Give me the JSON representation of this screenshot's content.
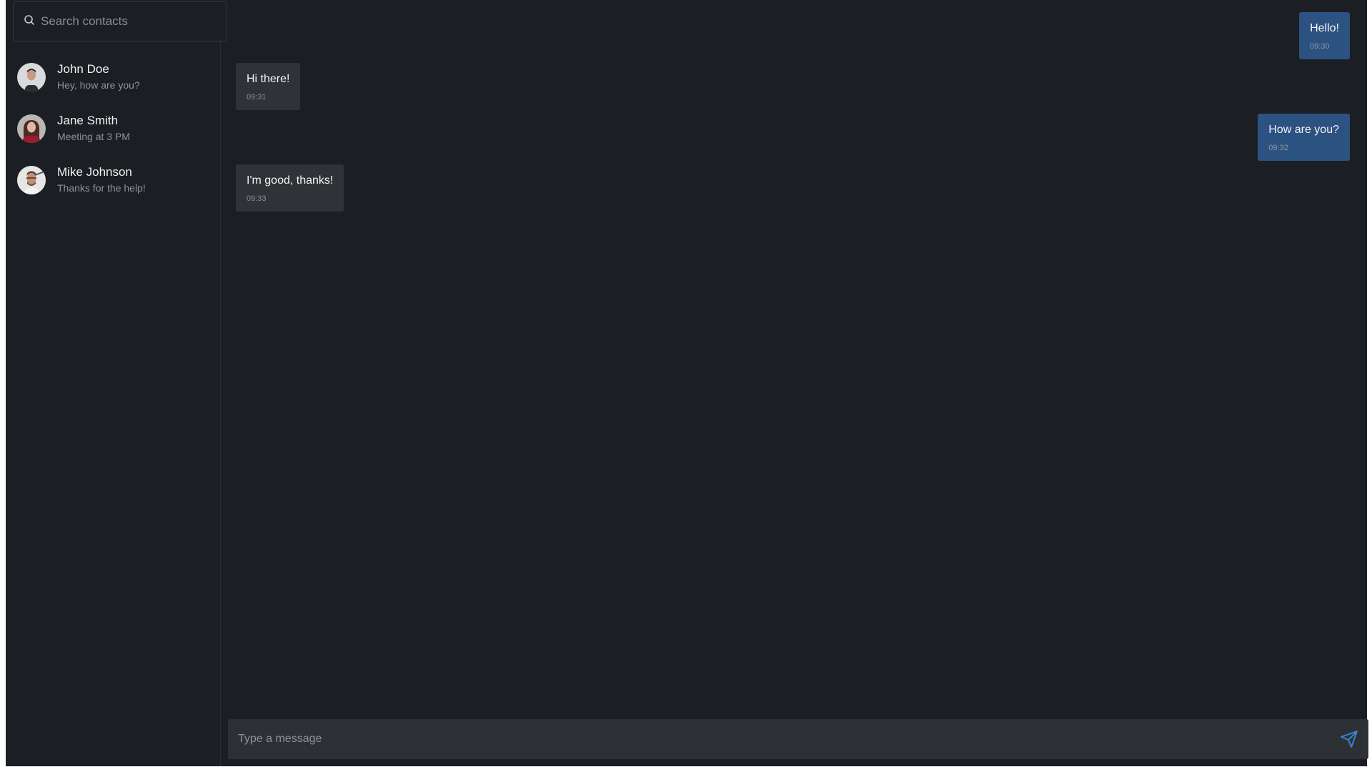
{
  "search": {
    "placeholder": "Search contacts"
  },
  "contacts": [
    {
      "name": "John Doe",
      "preview": "Hey, how are you?"
    },
    {
      "name": "Jane Smith",
      "preview": "Meeting at 3 PM"
    },
    {
      "name": "Mike Johnson",
      "preview": "Thanks for the help!"
    }
  ],
  "messages": [
    {
      "text": "Hello!",
      "time": "09:30",
      "direction": "out"
    },
    {
      "text": "Hi there!",
      "time": "09:31",
      "direction": "in"
    },
    {
      "text": "How are you?",
      "time": "09:32",
      "direction": "out"
    },
    {
      "text": "I'm good, thanks!",
      "time": "09:33",
      "direction": "in"
    }
  ],
  "composer": {
    "placeholder": "Type a message"
  },
  "icons": {
    "search": "search-icon",
    "send": "send-icon"
  },
  "colors": {
    "background": "#1b1e23",
    "outgoing_bubble": "#2c5282",
    "incoming_bubble": "#2f3236",
    "accent": "#3b82d6"
  }
}
